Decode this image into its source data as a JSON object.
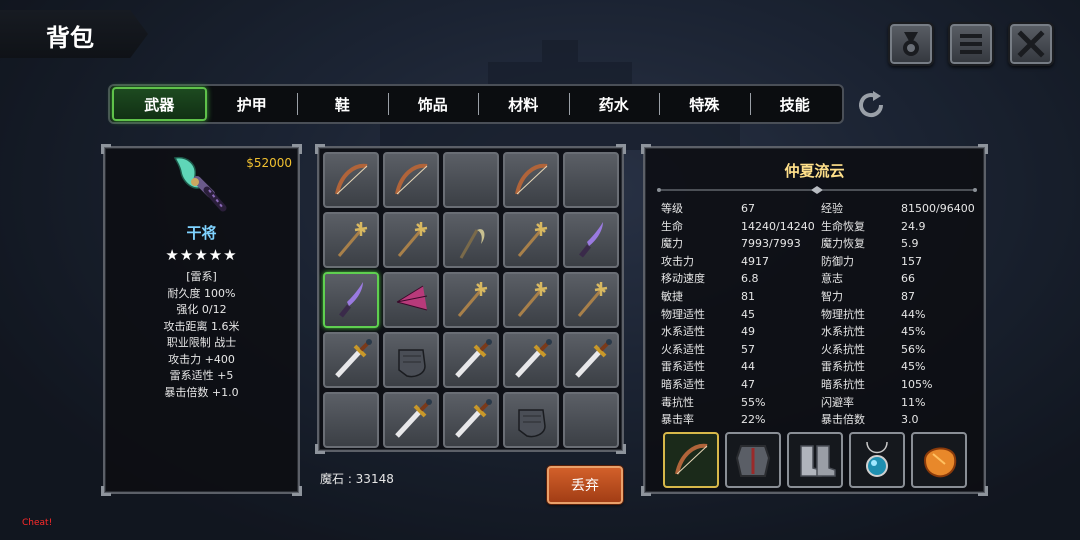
{
  "title": "背包",
  "tabs": [
    "武器",
    "护甲",
    "鞋",
    "饰品",
    "材料",
    "药水",
    "特殊",
    "技能"
  ],
  "active_tab": 0,
  "icons": {
    "medal": "medal-icon",
    "menu": "menu-icon",
    "close": "close-icon",
    "refresh": "refresh-icon"
  },
  "item": {
    "price": "$52000",
    "name": "干将",
    "stars": "★★★★★",
    "attributes": [
      "[雷系]",
      "耐久度 100%",
      "强化 0/12",
      "攻击距离  1.6米",
      "职业限制  战士",
      "攻击力  +400",
      "雷系适性  +5",
      "暴击倍数  +1.0"
    ]
  },
  "inventory": [
    [
      "bow",
      "bow",
      "empty",
      "bow",
      "empty"
    ],
    [
      "staff",
      "staff",
      "scythe",
      "staff",
      "dagger"
    ],
    [
      "dagger",
      "fan",
      "staff",
      "staff",
      "staff"
    ],
    [
      "sword",
      "gauntlet",
      "sword",
      "sword",
      "sword"
    ],
    [
      "empty",
      "sword",
      "sword",
      "gauntlet",
      "empty"
    ]
  ],
  "selected_cell": [
    2,
    0
  ],
  "magic_stone": "魔石 : 33148",
  "discard_label": "丢弃",
  "character": {
    "name": "仲夏流云",
    "stats": [
      [
        "等级",
        "67",
        "经验",
        "81500/96400"
      ],
      [
        "生命",
        "14240/14240",
        "生命恢复",
        "24.9"
      ],
      [
        "魔力",
        "7993/7993",
        "魔力恢复",
        "5.9"
      ],
      [
        "攻击力",
        "4917",
        "防御力",
        "157"
      ],
      [
        "移动速度",
        "6.8",
        "意志",
        "66"
      ],
      [
        "敏捷",
        "81",
        "智力",
        "87"
      ],
      [
        "物理适性",
        "45",
        "物理抗性",
        "44%"
      ],
      [
        "水系适性",
        "49",
        "水系抗性",
        "45%"
      ],
      [
        "火系适性",
        "57",
        "火系抗性",
        "56%"
      ],
      [
        "雷系适性",
        "44",
        "雷系抗性",
        "45%"
      ],
      [
        "暗系适性",
        "47",
        "暗系抗性",
        "105%"
      ],
      [
        "毒抗性",
        "55%",
        "闪避率",
        "11%"
      ],
      [
        "暴击率",
        "22%",
        "暴击倍数",
        "3.0"
      ]
    ],
    "equipment": [
      "bow",
      "chest-armor",
      "boots",
      "amulet",
      "gem"
    ]
  },
  "cheat_label": "Cheat!"
}
